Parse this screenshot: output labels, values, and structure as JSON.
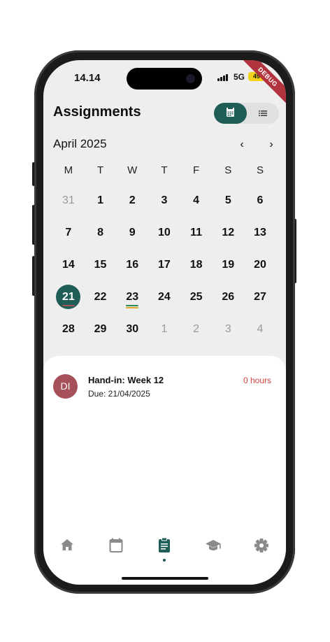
{
  "status_bar": {
    "time": "14.14",
    "network": "5G",
    "battery": "49",
    "debug_label": "DEBUG"
  },
  "header": {
    "title": "Assignments",
    "view_toggle": {
      "options": [
        "calendar-icon",
        "list-icon"
      ],
      "selected": "calendar"
    }
  },
  "calendar": {
    "month_label": "April 2025",
    "weekdays": [
      "M",
      "T",
      "W",
      "T",
      "F",
      "S",
      "S"
    ],
    "weeks": [
      [
        {
          "d": "31",
          "muted": true
        },
        {
          "d": "1"
        },
        {
          "d": "2"
        },
        {
          "d": "3"
        },
        {
          "d": "4"
        },
        {
          "d": "5"
        },
        {
          "d": "6"
        }
      ],
      [
        {
          "d": "7"
        },
        {
          "d": "8"
        },
        {
          "d": "9"
        },
        {
          "d": "10"
        },
        {
          "d": "11"
        },
        {
          "d": "12"
        },
        {
          "d": "13"
        }
      ],
      [
        {
          "d": "14"
        },
        {
          "d": "15"
        },
        {
          "d": "16"
        },
        {
          "d": "17"
        },
        {
          "d": "18"
        },
        {
          "d": "19"
        },
        {
          "d": "20"
        }
      ],
      [
        {
          "d": "21",
          "selected": true,
          "markers": [
            "#a6505a"
          ]
        },
        {
          "d": "22"
        },
        {
          "d": "23",
          "markers": [
            "#2e8b57",
            "#e0a82e"
          ]
        },
        {
          "d": "24"
        },
        {
          "d": "25"
        },
        {
          "d": "26"
        },
        {
          "d": "27"
        }
      ],
      [
        {
          "d": "28"
        },
        {
          "d": "29"
        },
        {
          "d": "30"
        },
        {
          "d": "1",
          "muted": true
        },
        {
          "d": "2",
          "muted": true
        },
        {
          "d": "3",
          "muted": true
        },
        {
          "d": "4",
          "muted": true
        }
      ]
    ],
    "selected_color": "#1f5d57"
  },
  "assignments": [
    {
      "initials": "DI",
      "title": "Hand-in: Week 12",
      "due": "Due: 21/04/2025",
      "remaining": "0 hours",
      "color": "#a6505a"
    }
  ],
  "bottom_nav": {
    "items": [
      "home-icon",
      "calendar-icon",
      "assignments-icon",
      "graduation-cap-icon",
      "settings-icon"
    ],
    "active": "assignments-icon"
  },
  "colors": {
    "accent": "#1f5d57",
    "alert": "#d64040",
    "background": "#eeeeee"
  }
}
